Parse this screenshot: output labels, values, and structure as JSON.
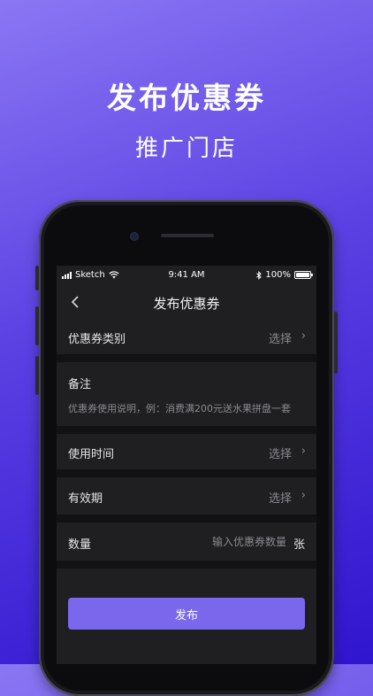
{
  "hero": {
    "title": "发布优惠券",
    "subtitle": "推广门店"
  },
  "status_bar": {
    "carrier": "Sketch",
    "time": "9:41 AM",
    "battery": "100%"
  },
  "nav": {
    "title": "发布优惠券"
  },
  "form": {
    "coupon_type": {
      "label": "优惠券类别",
      "value": "选择"
    },
    "note": {
      "label": "备注",
      "hint": "优惠券使用说明，例：消费满200元送水果拼盘一套"
    },
    "use_time": {
      "label": "使用时间",
      "value": "选择"
    },
    "validity": {
      "label": "有效期",
      "value": "选择"
    },
    "quantity": {
      "label": "数量",
      "placeholder": "输入优惠券数量",
      "unit": "张"
    },
    "submit_label": "发布"
  },
  "colors": {
    "background_gradient_start": "#8a77f3",
    "background_gradient_end": "#3015cf",
    "screen_background": "#1f1f21",
    "accent": "#7a67ec"
  }
}
